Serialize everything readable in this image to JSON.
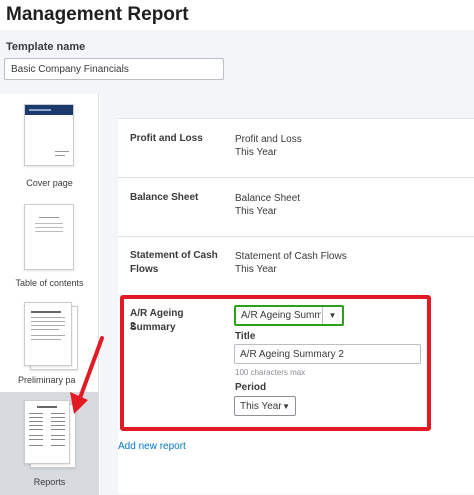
{
  "header": {
    "title": "Management Report"
  },
  "template": {
    "label": "Template name",
    "value": "Basic Company Financials"
  },
  "sidebar": {
    "items": [
      {
        "label": "Cover page"
      },
      {
        "label": "Table of contents"
      },
      {
        "label": "Preliminary pa"
      },
      {
        "label": "Reports"
      }
    ]
  },
  "reports": [
    {
      "name": "Profit and Loss",
      "value": "Profit and Loss",
      "period": "This Year"
    },
    {
      "name": "Balance Sheet",
      "value": "Balance Sheet",
      "period": "This Year"
    },
    {
      "name_line1": "Statement of Cash",
      "name_line2": "Flows",
      "value": "Statement of Cash Flows",
      "period": "This Year"
    }
  ],
  "editing": {
    "name_line1": "A/R Ageing Summary",
    "name_line2": "2",
    "report_select": "A/R Ageing Summary",
    "title_label": "Title",
    "title_value": "A/R Ageing Summary 2",
    "title_hint": "100 characters max",
    "period_label": "Period",
    "period_select": "This Year"
  },
  "add_report": "Add new report",
  "colors": {
    "accent_green": "#2ca01c",
    "highlight_red": "#e21a23",
    "link_blue": "#0077c5"
  },
  "icons": {
    "dropdown": "caret-down-icon",
    "annotation": "red-arrow-icon"
  }
}
